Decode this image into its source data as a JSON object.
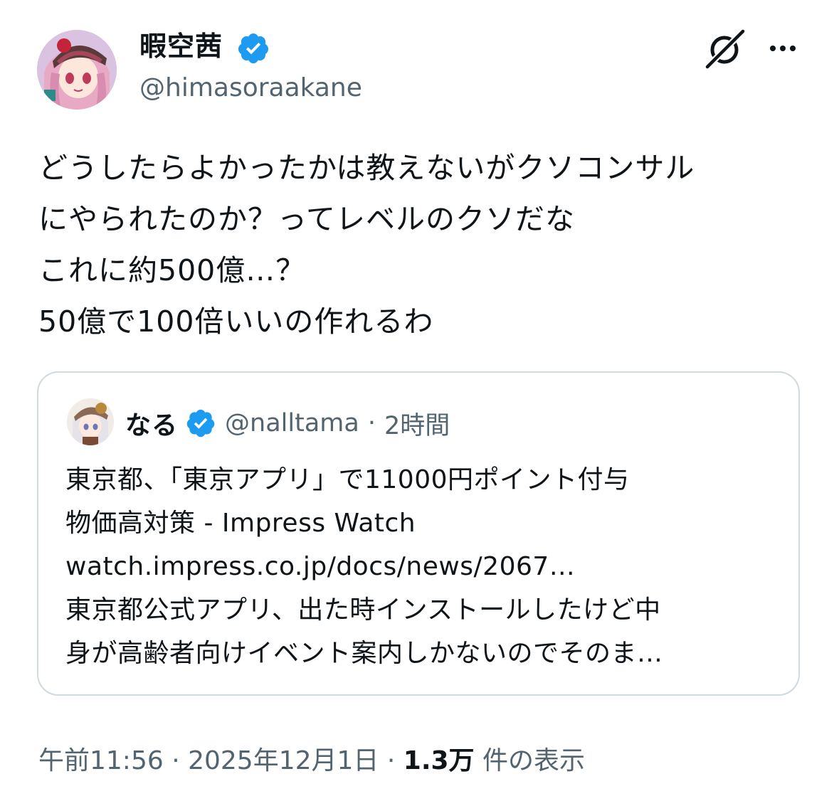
{
  "colors": {
    "text": "#0f1419",
    "muted": "#536471",
    "verified": "#1d9bf0",
    "border": "#cfd9de"
  },
  "author": {
    "display_name": "暇空茜",
    "handle": "@himasoraakane",
    "avatar_icon": "anime-girl-avatar",
    "verified_icon": "verified-badge-icon"
  },
  "header_actions": {
    "grok_icon": "grok-icon",
    "more_icon": "more-horizontal-icon"
  },
  "tweet": {
    "text": "どうしたらよかったかは教えないがクソコンサル\nにやられたのか？ってレベルのクソだな\nこれに約500億…？\n50億で100倍いいの作れるわ"
  },
  "quote": {
    "display_name": "なる",
    "handle": "@nalltama",
    "separator": "·",
    "time": "2時間",
    "avatar_icon": "anime-girl-avatar",
    "text": "東京都、「東京アプリ」で11000円ポイント付与\n物価高対策 - Impress Watch\nwatch.impress.co.jp/docs/news/2067…\n東京都公式アプリ、出た時インストールしたけど中\n身が高齢者向けイベント案内しかないのでそのま…"
  },
  "meta": {
    "time": "午前11:56",
    "sep1": " · ",
    "date": "2025年12月1日",
    "sep2": " · ",
    "views_count": "1.3万",
    "views_label": " 件の表示"
  }
}
